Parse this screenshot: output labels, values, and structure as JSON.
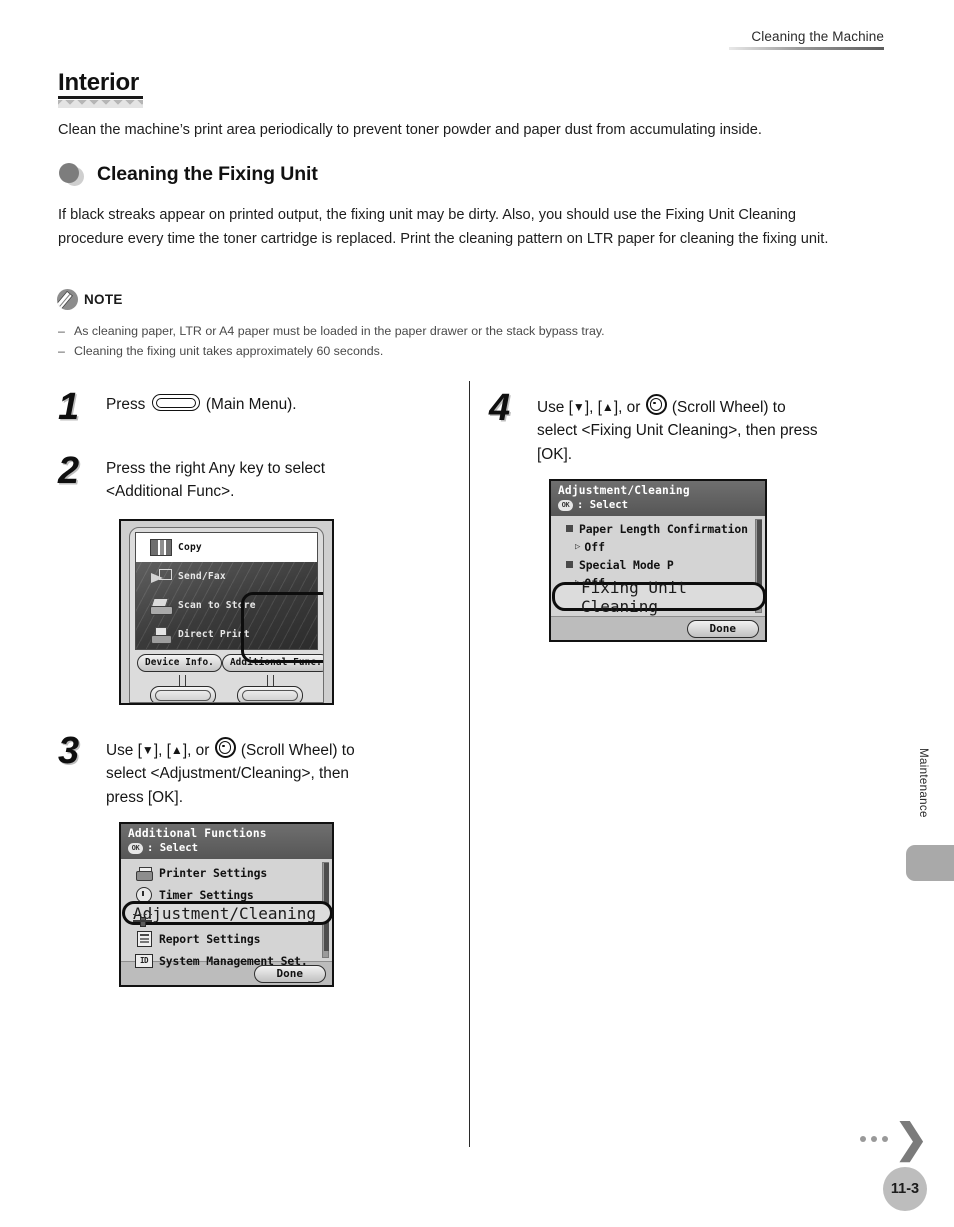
{
  "header": {
    "running_head": "Cleaning the Machine"
  },
  "chapter": {
    "title": "Interior",
    "intro": "Clean the machine’s print area periodically to prevent toner powder and paper dust from accumulating inside."
  },
  "section": {
    "title": "Cleaning the Fixing Unit",
    "body": "If black streaks appear on printed output, the fixing unit may be dirty. Also, you should use the Fixing Unit Cleaning procedure every time the toner cartridge is replaced. Print the cleaning pattern on LTR paper for cleaning the fixing unit."
  },
  "note": {
    "label": "NOTE",
    "dash": "–",
    "items": [
      "As cleaning paper, LTR or A4 paper must be loaded in the paper drawer or the stack bypass tray.",
      "Cleaning the fixing unit takes approximately 60 seconds."
    ]
  },
  "steps": {
    "one": {
      "number": "1",
      "text_before": "Press",
      "text_after": "(Main Menu)."
    },
    "two": {
      "number": "2",
      "line1": "Press the right Any key to select",
      "line2": "<Additional Func>."
    },
    "three": {
      "number": "3",
      "use_label": "Use [",
      "down_glyph": "▼",
      "mid_label": "], [",
      "up_glyph": "▲",
      "or_label": "], or",
      "wheel_label": "(Scroll Wheel) to",
      "line2": "select <Adjustment/Cleaning>, then",
      "line3": "press [OK]."
    },
    "four": {
      "number": "4",
      "use_label": "Use [",
      "down_glyph": "▼",
      "mid_label": "], [",
      "up_glyph": "▲",
      "or_label": "], or",
      "wheel_label": "(Scroll Wheel) to",
      "line2": "select <Fixing Unit Cleaning>, then press",
      "line3": "[OK]."
    }
  },
  "lcd_main_menu": {
    "rows": [
      {
        "label": "Copy",
        "icon": "copy-icon",
        "active": true
      },
      {
        "label": "Send/Fax",
        "icon": "send-fax-icon",
        "active": false
      },
      {
        "label": "Scan to Store",
        "icon": "scan-to-store-icon",
        "active": false
      },
      {
        "label": "Direct Print",
        "icon": "direct-print-icon",
        "active": false
      }
    ],
    "softkey_left": "Device Info.",
    "softkey_right": "Additional Func."
  },
  "lcd_additional_functions": {
    "title": "Additional Functions",
    "ok_badge": "OK",
    "subtitle": ": Select",
    "rows": [
      {
        "label": "Printer Settings",
        "icon": "printer-icon"
      },
      {
        "label": "Timer Settings",
        "icon": "clock-icon"
      },
      {
        "label": "Adjustment/Cleaning",
        "icon": "adjust-icon",
        "highlighted": true
      },
      {
        "label": "Report Settings",
        "icon": "report-icon"
      },
      {
        "label": "System Management Set.",
        "icon": "id-icon"
      }
    ],
    "done_label": "Done"
  },
  "lcd_adjustment_cleaning": {
    "title": "Adjustment/Cleaning",
    "ok_badge": "OK",
    "subtitle": ": Select",
    "rows": [
      {
        "label": "Paper Length Confirmation",
        "value": "Off"
      },
      {
        "label": "Special Mode P",
        "value": "Off"
      }
    ],
    "highlighted_row": "Fixing Unit Cleaning",
    "value_arrow": "▷",
    "done_label": "Done"
  },
  "side_tab": {
    "label": "Maintenance"
  },
  "footer": {
    "page_number": "11-3",
    "chevron": "❯"
  }
}
